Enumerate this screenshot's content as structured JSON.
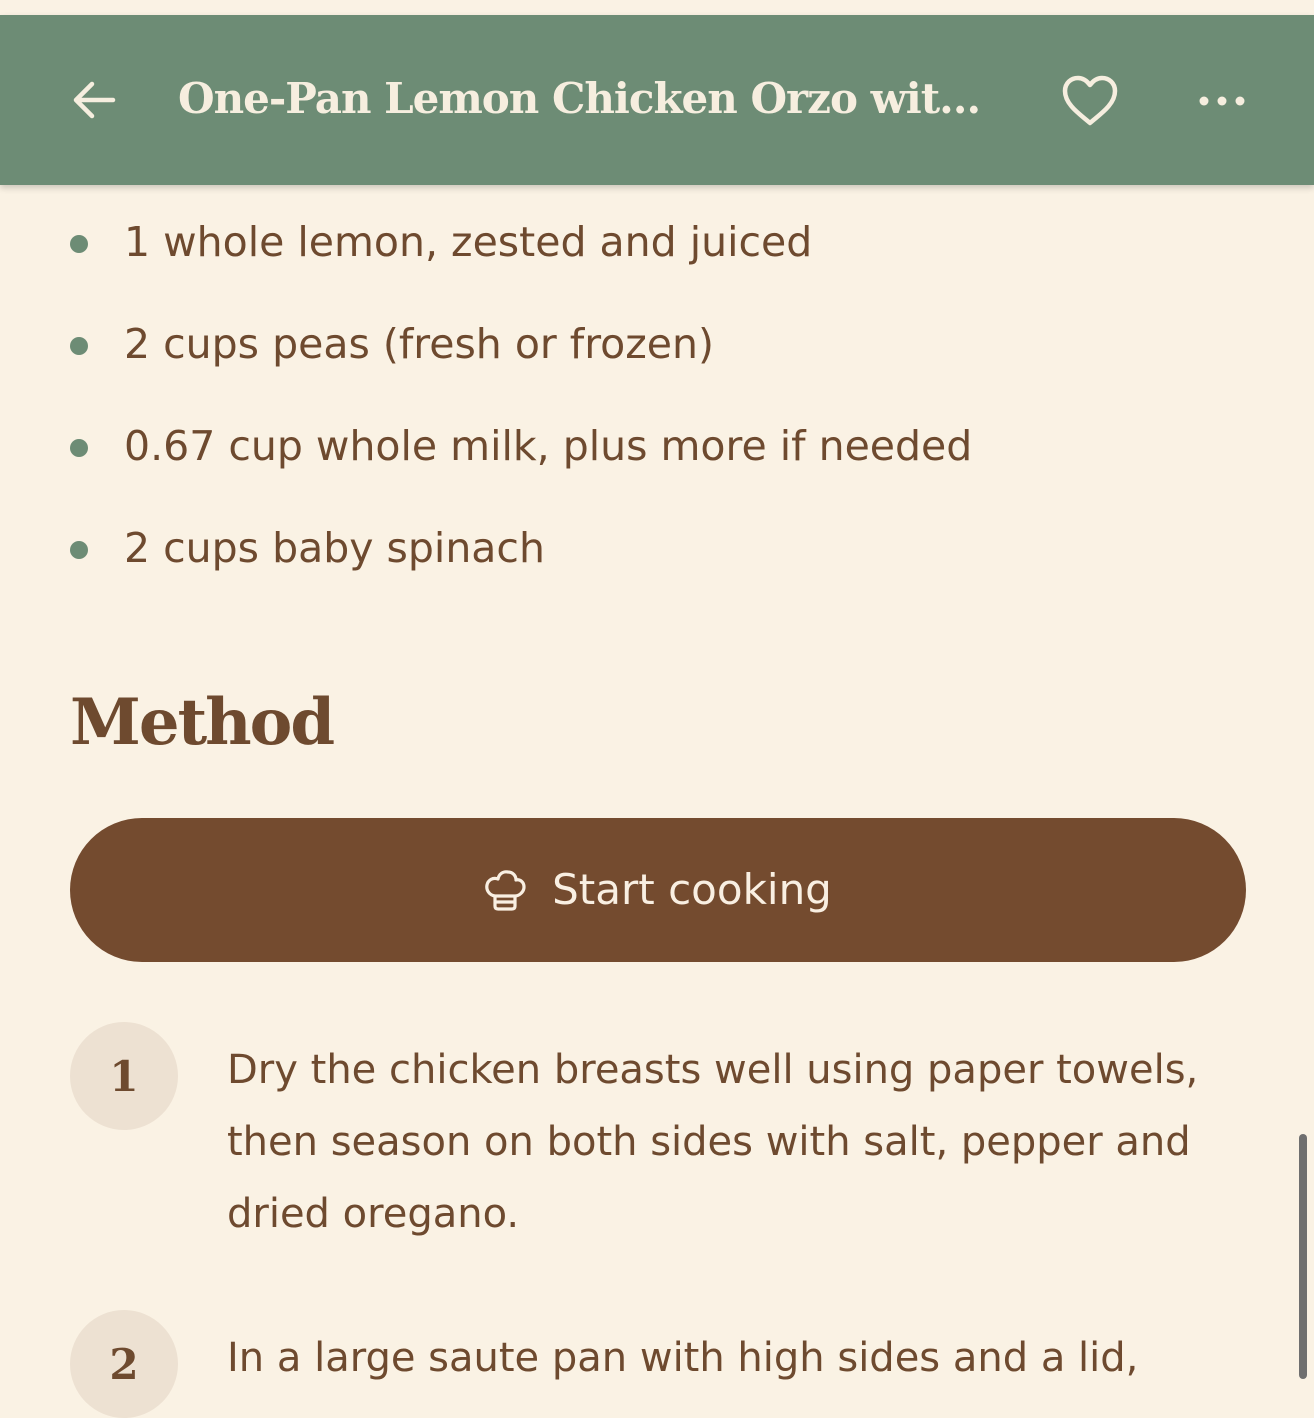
{
  "header": {
    "title": "One-Pan Lemon Chicken Orzo with Pe...",
    "back_icon": "arrow-left-icon",
    "favorite_icon": "heart-outline-icon",
    "more_icon": "more-horizontal-icon"
  },
  "ingredients": [
    "1 whole lemon, zested and juiced",
    "2 cups peas (fresh or frozen)",
    "0.67 cup whole milk, plus more if needed",
    "2 cups baby spinach"
  ],
  "method": {
    "heading": "Method",
    "start_button": {
      "label": "Start cooking",
      "icon": "chef-hat-icon"
    },
    "steps": [
      {
        "number": "1",
        "text": "Dry the chicken breasts well using paper towels, then season on both sides with salt, pepper and dried oregano."
      },
      {
        "number": "2",
        "text": "In a large saute pan with high sides and a lid,"
      }
    ]
  },
  "colors": {
    "header_bg": "#6D8C75",
    "page_bg": "#FAF2E4",
    "text_brown": "#6E4A2F",
    "button_bg": "#744B2F",
    "bullet_green": "#6D8C75",
    "step_circle_bg": "#EDE1D2"
  }
}
